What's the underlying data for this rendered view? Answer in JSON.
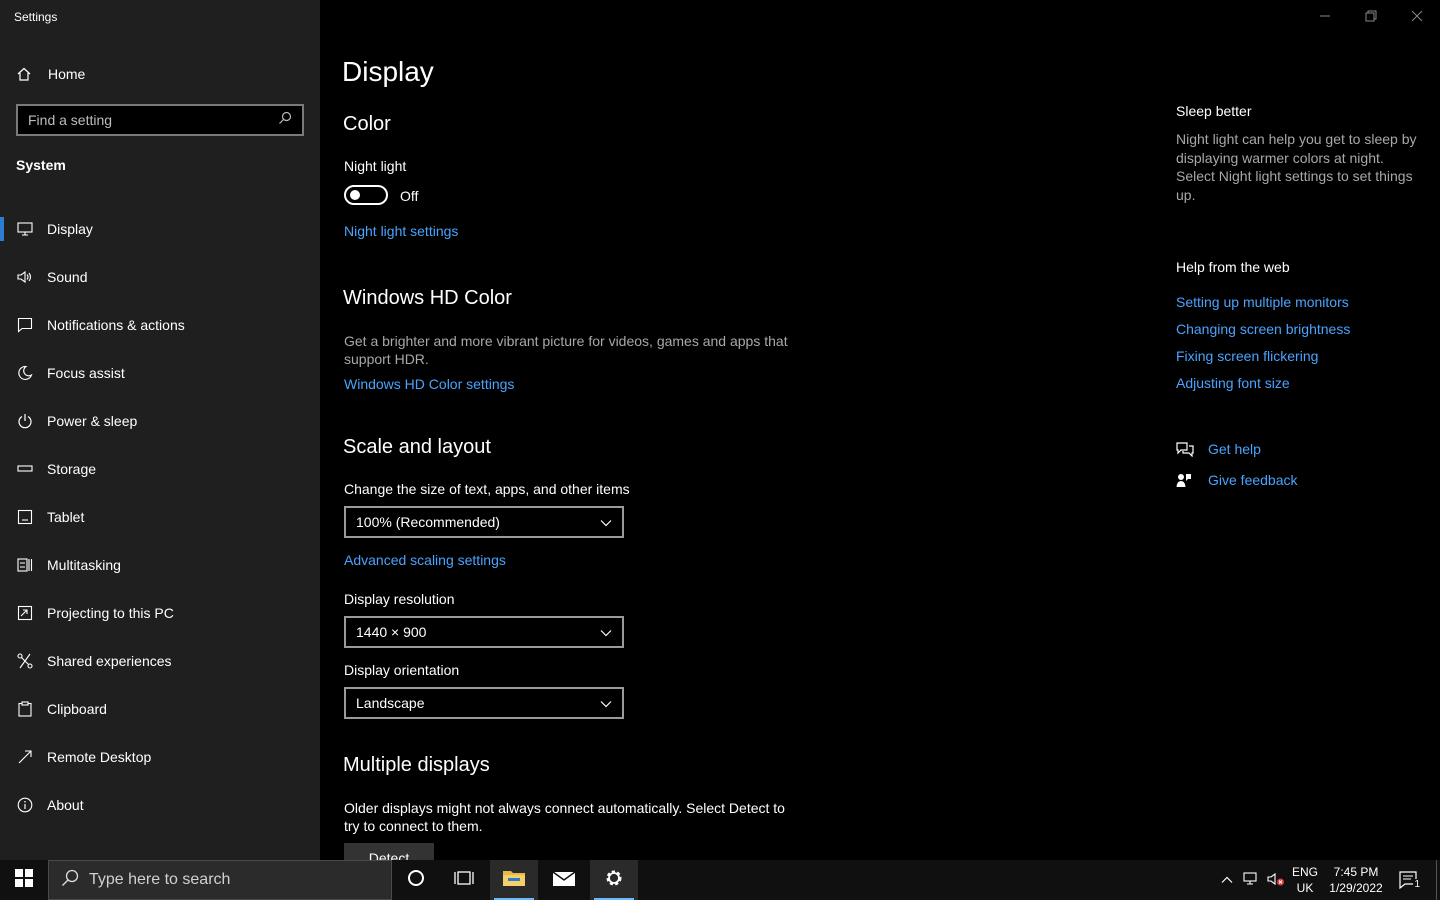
{
  "app": {
    "title": "Settings"
  },
  "sidebar": {
    "home_label": "Home",
    "search_placeholder": "Find a setting",
    "section": "System",
    "items": [
      {
        "label": "Display",
        "icon": "monitor-icon"
      },
      {
        "label": "Sound",
        "icon": "speaker-icon"
      },
      {
        "label": "Notifications & actions",
        "icon": "notification-icon"
      },
      {
        "label": "Focus assist",
        "icon": "moon-icon"
      },
      {
        "label": "Power & sleep",
        "icon": "power-icon"
      },
      {
        "label": "Storage",
        "icon": "storage-icon"
      },
      {
        "label": "Tablet",
        "icon": "tablet-icon"
      },
      {
        "label": "Multitasking",
        "icon": "multitasking-icon"
      },
      {
        "label": "Projecting to this PC",
        "icon": "projecting-icon"
      },
      {
        "label": "Shared experiences",
        "icon": "shared-icon"
      },
      {
        "label": "Clipboard",
        "icon": "clipboard-icon"
      },
      {
        "label": "Remote Desktop",
        "icon": "remote-desktop-icon"
      },
      {
        "label": "About",
        "icon": "info-icon"
      }
    ]
  },
  "main": {
    "title": "Display",
    "color": {
      "heading": "Color",
      "night_light_label": "Night light",
      "night_light_state": "Off",
      "night_light_link": "Night light settings"
    },
    "hdr": {
      "heading": "Windows HD Color",
      "description": "Get a brighter and more vibrant picture for videos, games and apps that support HDR.",
      "link": "Windows HD Color settings"
    },
    "scale": {
      "heading": "Scale and layout",
      "size_label": "Change the size of text, apps, and other items",
      "size_value": "100% (Recommended)",
      "advanced_link": "Advanced scaling settings",
      "resolution_label": "Display resolution",
      "resolution_value": "1440 × 900",
      "orientation_label": "Display orientation",
      "orientation_value": "Landscape"
    },
    "multiple": {
      "heading": "Multiple displays",
      "description": "Older displays might not always connect automatically. Select Detect to try to connect to them.",
      "detect_label": "Detect"
    }
  },
  "right_panel": {
    "sleep_title": "Sleep better",
    "sleep_desc": "Night light can help you get to sleep by displaying warmer colors at night. Select Night light settings to set things up.",
    "help_title": "Help from the web",
    "help_links": [
      "Setting up multiple monitors",
      "Changing screen brightness",
      "Fixing screen flickering",
      "Adjusting font size"
    ],
    "get_help": "Get help",
    "give_feedback": "Give feedback"
  },
  "taskbar": {
    "search_placeholder": "Type here to search",
    "lang_top": "ENG",
    "lang_bottom": "UK",
    "time": "7:45 PM",
    "date": "1/29/2022",
    "notification_count": "1"
  },
  "colors": {
    "accent": "#4aa3ff",
    "sidebar_bg": "#1f1f1f",
    "taskbar_bg": "#101010"
  }
}
